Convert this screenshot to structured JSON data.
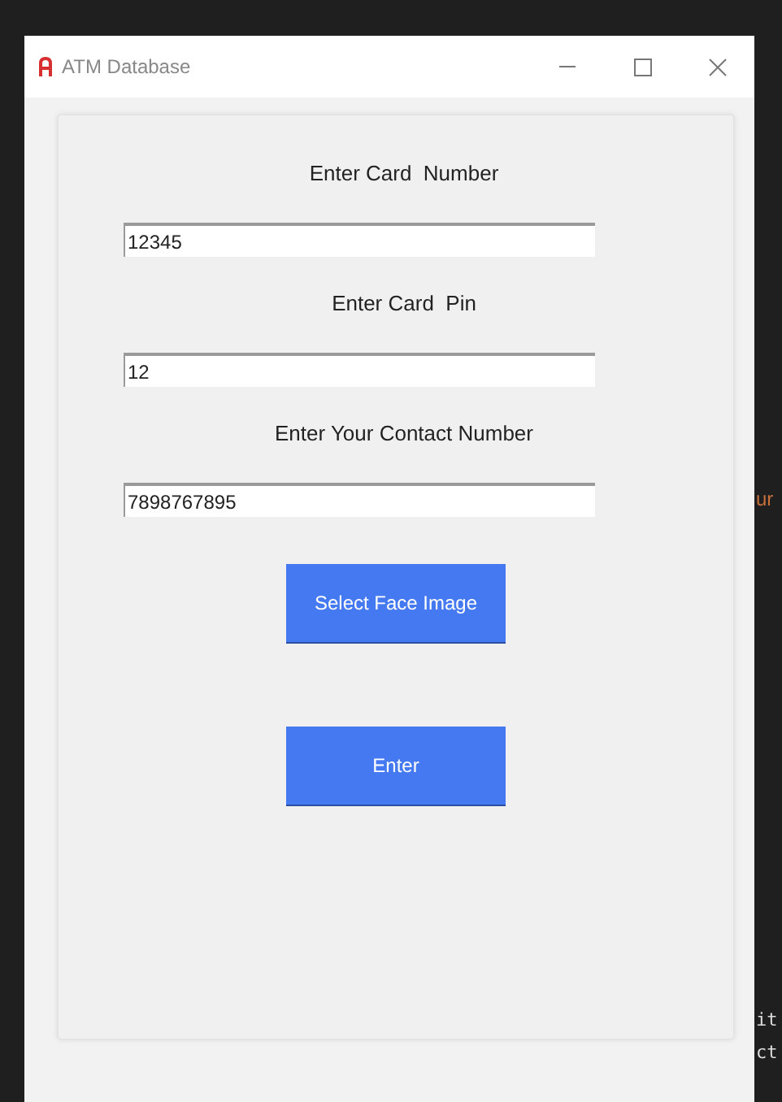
{
  "window": {
    "title": "ATM Database"
  },
  "form": {
    "fields": [
      {
        "label": "Enter Card  Number",
        "value": "12345"
      },
      {
        "label": "Enter Card  Pin",
        "value": "12"
      },
      {
        "label": "Enter Your Contact Number",
        "value": "7898767895"
      }
    ],
    "buttons": [
      "Select Face Image",
      "Enter"
    ]
  },
  "background_fragments": [
    {
      "text": "ur",
      "kind": "orange"
    },
    {
      "text": "it",
      "kind": "mono"
    },
    {
      "text": "ct",
      "kind": "mono"
    }
  ]
}
